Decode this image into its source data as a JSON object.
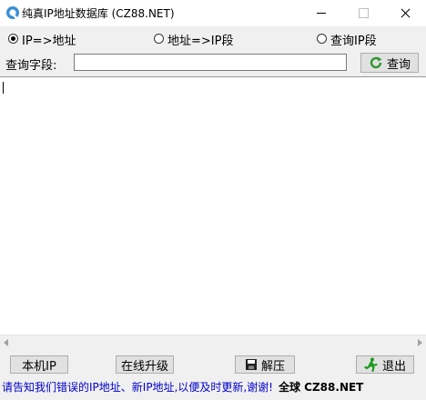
{
  "window": {
    "title": "纯真IP地址数据库  (CZ88.NET)"
  },
  "modes": [
    {
      "label": "IP=>地址",
      "selected": true
    },
    {
      "label": "地址=>IP段",
      "selected": false
    },
    {
      "label": "查询IP段",
      "selected": false
    }
  ],
  "query": {
    "label": "查询字段:",
    "value": "",
    "button_label": "查询"
  },
  "result": {
    "text": ""
  },
  "buttons": {
    "local_ip": "本机IP",
    "online_update": "在线升级",
    "unzip": "解压",
    "exit": "退出"
  },
  "status": {
    "message": "请告知我们错误的IP地址、新IP地址,以便及时更新,谢谢!",
    "brand": "全球  CZ88.NET"
  },
  "colors": {
    "status_text": "#0000cc",
    "refresh_icon": "#2e9a2e",
    "exit_icon": "#1e9a1e"
  }
}
